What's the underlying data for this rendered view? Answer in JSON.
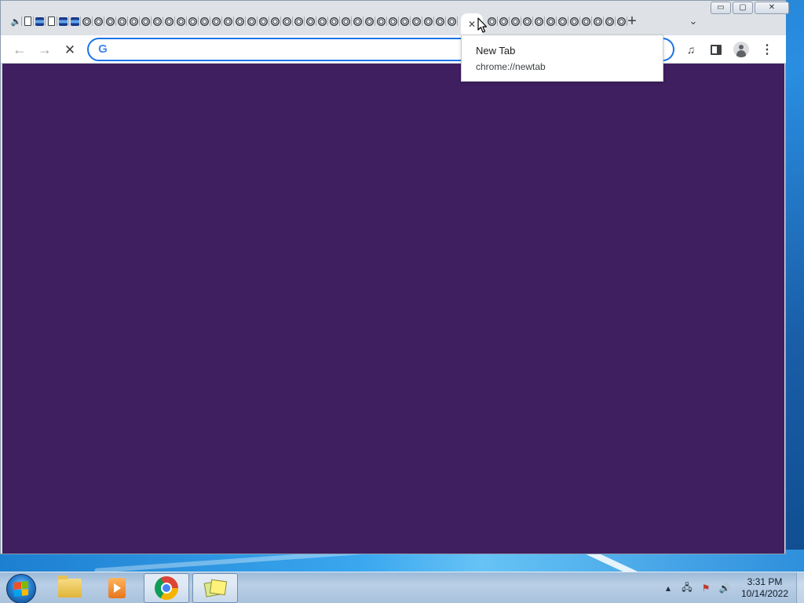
{
  "browser": {
    "tab_strip": {
      "active_tab_icon": "close-icon",
      "active_tab_glyph": "✕",
      "new_tab_glyph": "+",
      "tab_search_glyph": "⌄",
      "audio_glyph": "🔈",
      "other_tab_count": 44
    },
    "window_controls": {
      "minimize_glyph": "▭",
      "maximize_glyph": "▢",
      "close_glyph": "✕"
    },
    "toolbar": {
      "back_glyph": "←",
      "forward_glyph": "→",
      "stop_glyph": "✕",
      "omnibox_value": "",
      "omnibox_placeholder": "",
      "google_glyph": "G",
      "media_glyph": "♫",
      "menu_glyph": "⋮"
    },
    "tooltip": {
      "title": "New Tab",
      "url": "chrome://newtab"
    },
    "content_background": "#3f1f60"
  },
  "taskbar": {
    "clock_time": "3:31 PM",
    "clock_date": "10/14/2022",
    "tray": {
      "expand_glyph": "▴",
      "network_glyph": "🖧",
      "action_center_glyph": "⚑",
      "volume_glyph": "🔊"
    },
    "pinned": [
      "windows-explorer",
      "media-player",
      "chrome",
      "sticky-notes"
    ],
    "active_app": "chrome"
  },
  "colors": {
    "accent": "#1a73e8",
    "tabstrip": "#dee1e6",
    "page_bg": "#3f1f60"
  }
}
